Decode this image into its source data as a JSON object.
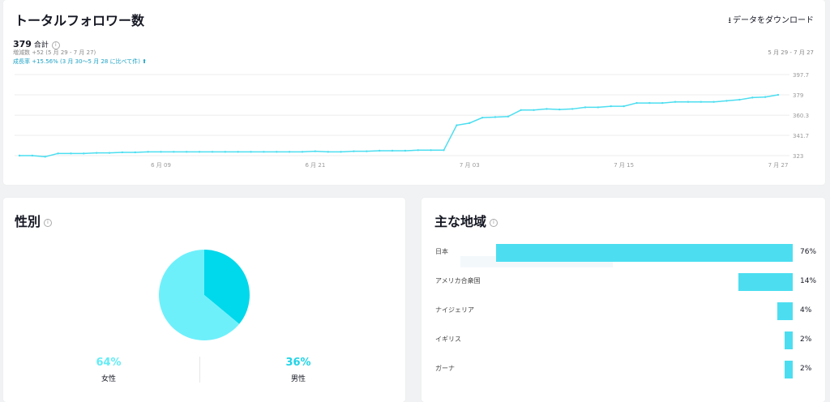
{
  "followers": {
    "title": "トータルフォロワー数",
    "download_label": "データをダウンロード",
    "total_value": "379",
    "total_suffix": "合計",
    "increase": "増減数 +52 (5 月 29 - 7 月 27)",
    "growth": "成長率 +15.56% (3 月 30〜5 月 28 に比べて件) ⬆",
    "range": "5 月 29 - 7 月 27"
  },
  "gender": {
    "title": "性別",
    "female_pct": "64%",
    "female_label": "女性",
    "male_pct": "36%",
    "male_label": "男性"
  },
  "region": {
    "title": "主な地域",
    "items": [
      {
        "label": "日本",
        "pct": "76%",
        "value": 76
      },
      {
        "label": "アメリカ合衆国",
        "pct": "14%",
        "value": 14
      },
      {
        "label": "ナイジェリア",
        "pct": "4%",
        "value": 4
      },
      {
        "label": "イギリス",
        "pct": "2%",
        "value": 2
      },
      {
        "label": "ガーナ",
        "pct": "2%",
        "value": 2
      }
    ]
  },
  "colors": {
    "line": "#4cdef0",
    "female": "#6ef0fb",
    "male": "#00d8eb",
    "bar": "#4cdef0",
    "female_text": "#64ecf5",
    "male_text": "#22d4e6"
  },
  "chart_data": [
    {
      "type": "line",
      "title": "トータルフォロワー数",
      "xlabel": "",
      "ylabel": "",
      "x": [
        "5 月 29",
        "5 月 30",
        "5 月 31",
        "6 月 01",
        "6 月 02",
        "6 月 03",
        "6 月 04",
        "6 月 05",
        "6 月 06",
        "6 月 07",
        "6 月 08",
        "6 月 09",
        "6 月 10",
        "6 月 11",
        "6 月 12",
        "6 月 13",
        "6 月 14",
        "6 月 15",
        "6 月 16",
        "6 月 17",
        "6 月 18",
        "6 月 19",
        "6 月 20",
        "6 月 21",
        "6 月 22",
        "6 月 23",
        "6 月 24",
        "6 月 25",
        "6 月 26",
        "6 月 27",
        "6 月 28",
        "6 月 29",
        "6 月 30",
        "7 月 01",
        "7 月 02",
        "7 月 03",
        "7 月 04",
        "7 月 05",
        "7 月 06",
        "7 月 07",
        "7 月 08",
        "7 月 09",
        "7 月 10",
        "7 月 11",
        "7 月 12",
        "7 月 13",
        "7 月 14",
        "7 月 15",
        "7 月 16",
        "7 月 17",
        "7 月 18",
        "7 月 19",
        "7 月 20",
        "7 月 21",
        "7 月 22",
        "7 月 23",
        "7 月 24",
        "7 月 25",
        "7 月 26",
        "7 月 27"
      ],
      "values": [
        323,
        323,
        322,
        325,
        325,
        325,
        325.5,
        325.5,
        326,
        326,
        326.5,
        326.5,
        326.5,
        326.5,
        326.5,
        326.5,
        326.5,
        326.5,
        326.5,
        326.5,
        326.5,
        326.5,
        326.5,
        327,
        326.5,
        326.5,
        327,
        327,
        327.5,
        327.5,
        327.5,
        328,
        328,
        328,
        351,
        353,
        358,
        358.5,
        359,
        365,
        365,
        366,
        365.5,
        366,
        367.5,
        367.5,
        368.5,
        368.5,
        371.5,
        371.5,
        371.5,
        372.5,
        372.5,
        372.5,
        372.5,
        373.5,
        374.5,
        376.5,
        377,
        379
      ],
      "xticks": [
        "6 月 09",
        "6 月 21",
        "7 月 03",
        "7 月 15",
        "7 月 27"
      ],
      "yticks": [
        323,
        341.7,
        360.3,
        379,
        397.7
      ],
      "ylim": [
        323,
        397.7
      ],
      "grid": true
    },
    {
      "type": "pie",
      "title": "性別",
      "categories": [
        "女性",
        "男性"
      ],
      "values": [
        64,
        36
      ]
    },
    {
      "type": "bar",
      "title": "主な地域",
      "categories": [
        "日本",
        "アメリカ合衆国",
        "ナイジェリア",
        "イギリス",
        "ガーナ"
      ],
      "values": [
        76,
        14,
        4,
        2,
        2
      ]
    }
  ]
}
